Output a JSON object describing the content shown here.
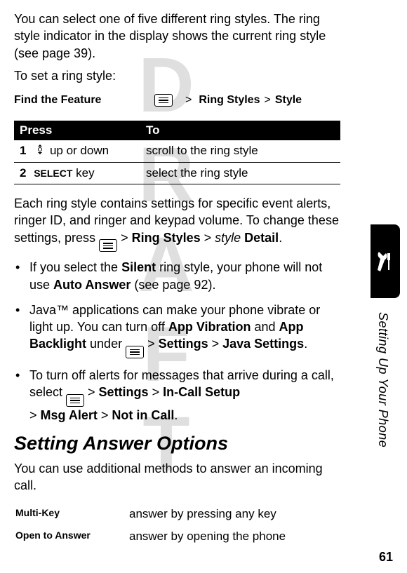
{
  "intro1": "You can select one of five different ring styles. The ring style indicator in the display shows the current ring style (see page 39).",
  "intro2": "To set a ring style:",
  "feature": {
    "label": "Find the Feature",
    "chevron1": ">",
    "ring_styles": "Ring Styles",
    "chevron2": ">",
    "style": "Style"
  },
  "table": {
    "header_press": "Press",
    "header_to": "To",
    "row1_num": "1",
    "row1_press": "up or down",
    "row1_to": "scroll to the ring style",
    "row2_num": "2",
    "row2_press_key": "SELECT",
    "row2_press_suffix": " key",
    "row2_to": "select the ring style"
  },
  "para2_a": "Each ring style contains settings for specific event alerts, ringer ID, and ringer and keypad volume. To change these settings, press ",
  "para2_b": " > ",
  "para2_ring": "Ring Styles",
  "para2_c": " > ",
  "para2_style": "style",
  "para2_sp": " ",
  "para2_detail": "Detail",
  "para2_end": ".",
  "bullets": {
    "b1_a": "If you select the ",
    "b1_silent": "Silent",
    "b1_b": " ring style, your phone will not use ",
    "b1_auto": "Auto Answer",
    "b1_c": " (see page 92).",
    "b2_a": "Java™ applications can make your phone vibrate or light up. You can turn off ",
    "b2_vib": "App Vibration",
    "b2_b": " and ",
    "b2_back": "App Backlight",
    "b2_c": " under ",
    "b2_d": " > ",
    "b2_settings": "Settings",
    "b2_e": " > ",
    "b2_java": "Java Settings",
    "b2_end": ".",
    "b3_a": "To turn off alerts for messages that arrive during a call, select ",
    "b3_b": " > ",
    "b3_settings": "Settings",
    "b3_c": " > ",
    "b3_incall": "In-Call Setup",
    "b3_d": " > ",
    "b3_msg": "Msg Alert",
    "b3_e": " > ",
    "b3_not": "Not in Call",
    "b3_end": "."
  },
  "heading": "Setting Answer Options",
  "para3": "You can use additional methods to answer an incoming call.",
  "answer": {
    "opt1": "Multi-Key",
    "opt1_desc": "answer by pressing any key",
    "opt2": "Open to Answer",
    "opt2_desc": "answer by opening the phone"
  },
  "side_label": "Setting Up Your Phone",
  "page_num": "61",
  "watermark": "DRAFT"
}
